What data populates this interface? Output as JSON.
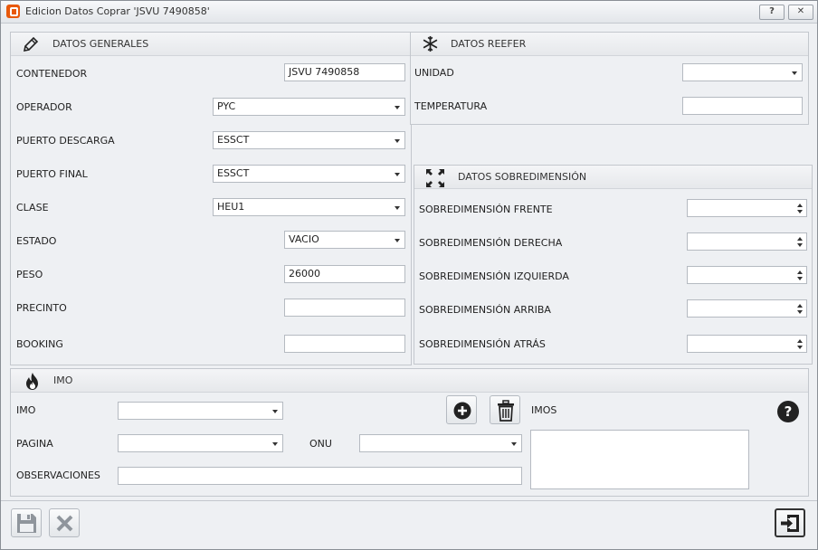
{
  "window": {
    "title": "Edicion Datos Coprar  'JSVU 7490858'",
    "help_label": "?",
    "close_label": "✕"
  },
  "generales": {
    "title": "DATOS GENERALES",
    "contenedor": {
      "label": "CONTENEDOR",
      "value": "JSVU 7490858"
    },
    "operador": {
      "label": "OPERADOR",
      "value": "PYC"
    },
    "puerto_descarga": {
      "label": "PUERTO DESCARGA",
      "value": "ESSCT"
    },
    "puerto_final": {
      "label": "PUERTO FINAL",
      "value": "ESSCT"
    },
    "clase": {
      "label": "CLASE",
      "value": "HEU1"
    },
    "estado": {
      "label": "ESTADO",
      "value": "VACIO"
    },
    "peso": {
      "label": "PESO",
      "value": "26000"
    },
    "precinto": {
      "label": "PRECINTO",
      "value": ""
    },
    "booking": {
      "label": "BOOKING",
      "value": ""
    }
  },
  "reefer": {
    "title": "DATOS REEFER",
    "unidad": {
      "label": "UNIDAD",
      "value": ""
    },
    "temperatura": {
      "label": "TEMPERATURA",
      "value": ""
    }
  },
  "sobredimension": {
    "title": "DATOS SOBREDIMENSIÓN",
    "frente": {
      "label": "SOBREDIMENSIÓN FRENTE",
      "value": ""
    },
    "derecha": {
      "label": "SOBREDIMENSIÓN DERECHA",
      "value": ""
    },
    "izquierda": {
      "label": "SOBREDIMENSIÓN IZQUIERDA",
      "value": ""
    },
    "arriba": {
      "label": "SOBREDIMENSIÓN ARRIBA",
      "value": ""
    },
    "atras": {
      "label": "SOBREDIMENSIÓN ATRÁS",
      "value": ""
    }
  },
  "imo": {
    "title": "IMO",
    "imo": {
      "label": "IMO",
      "value": ""
    },
    "pagina": {
      "label": "PAGINA",
      "value": ""
    },
    "onu": {
      "label": "ONU",
      "value": ""
    },
    "observaciones": {
      "label": "OBSERVACIONES",
      "value": ""
    },
    "imos_label": "IMOS",
    "help_label": "?"
  },
  "icons": {
    "edit": "pencil-icon",
    "reefer": "snowflake-icon",
    "sobredimension": "expand-icon",
    "imo": "fire-icon",
    "add": "plus-circle-icon",
    "delete": "trash-icon",
    "help": "question-circle-icon",
    "save": "floppy-disk-icon",
    "cancel": "x-icon",
    "exit": "exit-icon"
  }
}
